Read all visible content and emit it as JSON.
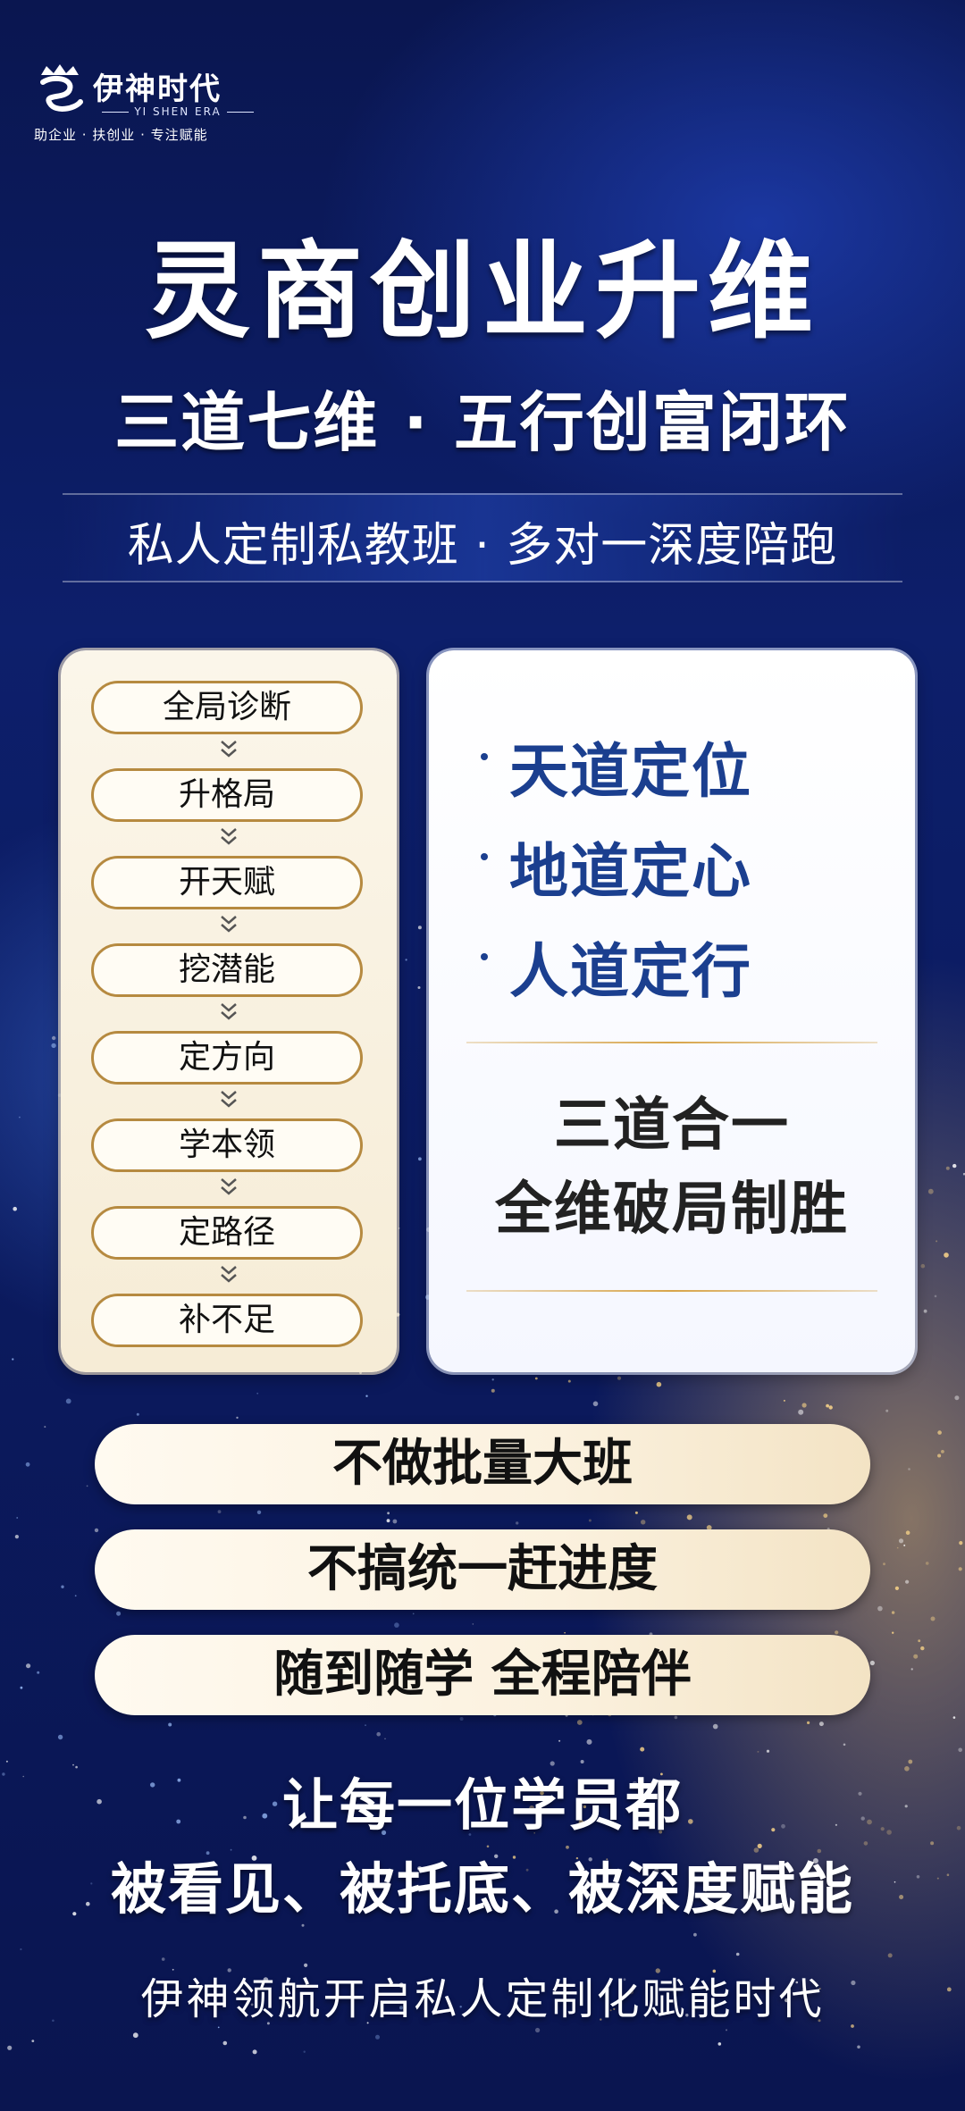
{
  "brand": {
    "name": "伊神时代",
    "en_name": "YI SHEN ERA",
    "slogan": "助企业 · 扶创业 · 专注赋能"
  },
  "hero": {
    "title": "灵商创业升维",
    "subtitle": "三道七维 · 五行创富闭环",
    "class_type": "私人定制私教班 · 多对一深度陪跑"
  },
  "steps": [
    "全局诊断",
    "升格局",
    "开天赋",
    "挖潜能",
    "定方向",
    "学本领",
    "定路径",
    "补不足"
  ],
  "three_dao": {
    "items": [
      "天道定位",
      "地道定心",
      "人道定行"
    ],
    "slogan_line1": "三道合一",
    "slogan_line2": "全维破局制胜"
  },
  "features": [
    "不做批量大班",
    "不搞统一赶进度",
    "随到随学  全程陪伴"
  ],
  "promise": {
    "line1": "让每一位学员都",
    "line2": "被看见、被托底、被深度赋能"
  },
  "footer": "伊神领航开启私人定制化赋能时代",
  "colors": {
    "background": "#0d1f6b",
    "accent_gold": "#b68a40",
    "dao_blue": "#1b3f8f"
  }
}
